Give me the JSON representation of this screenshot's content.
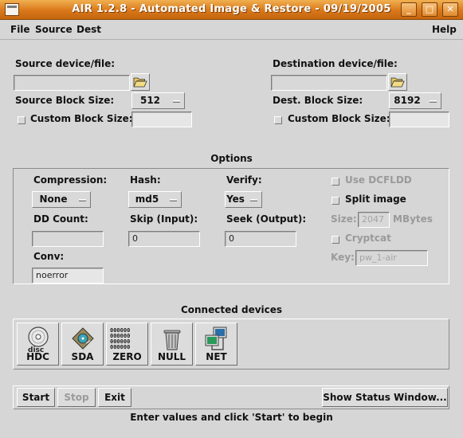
{
  "window": {
    "title": "AIR 1.2.8 - Automated Image & Restore - 09/19/2005"
  },
  "menubar": {
    "file": "File",
    "source": "Source",
    "dest": "Dest",
    "help": "Help"
  },
  "source": {
    "label": "Source device/file:",
    "value": "",
    "block_size_label": "Source Block Size:",
    "block_size": "512",
    "custom_label": "Custom Block Size:",
    "custom_value": ""
  },
  "dest": {
    "label": "Destination device/file:",
    "value": "",
    "block_size_label": "Dest. Block Size:",
    "block_size": "8192",
    "custom_label": "Custom Block Size:",
    "custom_value": ""
  },
  "options": {
    "heading": "Options",
    "compression_label": "Compression:",
    "compression": "None",
    "hash_label": "Hash:",
    "hash": "md5",
    "verify_label": "Verify:",
    "verify": "Yes",
    "dd_count_label": "DD Count:",
    "dd_count": "",
    "skip_label": "Skip (Input):",
    "skip": "0",
    "seek_label": "Seek (Output):",
    "seek": "0",
    "conv_label": "Conv:",
    "conv": "noerror",
    "use_dcfldd_label": "Use DCFLDD",
    "split_image_label": "Split image",
    "size_label": "Size:",
    "size_value": "2047",
    "size_unit": "MBytes",
    "cryptcat_label": "Cryptcat",
    "key_label": "Key:",
    "key_value": "pw_1-air"
  },
  "devices": {
    "heading": "Connected devices",
    "items": [
      {
        "label": "HDC",
        "icon": "cd-disc-icon"
      },
      {
        "label": "SDA",
        "icon": "hard-disk-icon"
      },
      {
        "label": "ZERO",
        "icon": "zero-grid-icon"
      },
      {
        "label": "NULL",
        "icon": "trash-can-icon"
      },
      {
        "label": "NET",
        "icon": "network-computer-icon"
      }
    ]
  },
  "actions": {
    "start": "Start",
    "stop": "Stop",
    "exit": "Exit",
    "status_window": "Show Status Window..."
  },
  "status": "Enter values and click 'Start' to begin"
}
